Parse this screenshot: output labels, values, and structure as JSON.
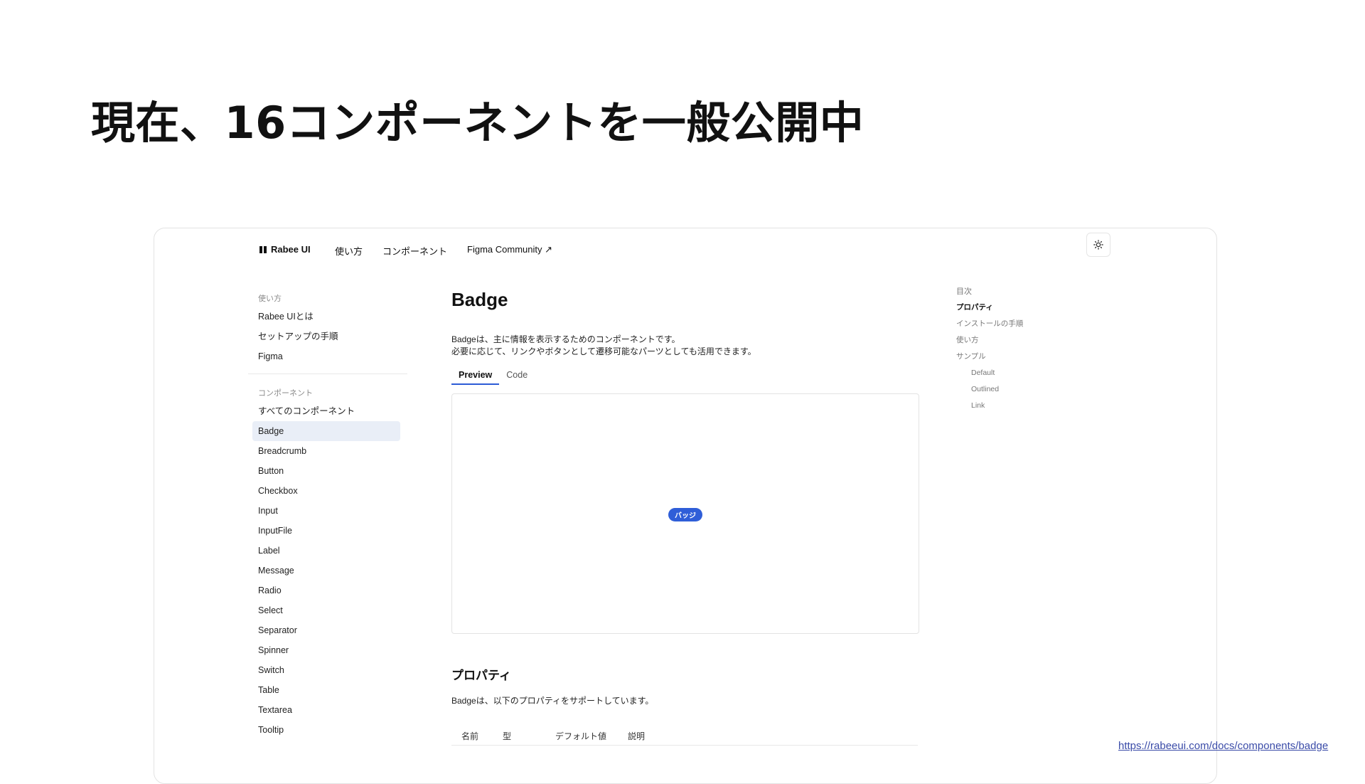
{
  "slide": {
    "title": "現在、16コンポーネントを一般公開中",
    "url": "https://rabeeui.com/docs/components/badge"
  },
  "nav": {
    "brand": "Rabee UI",
    "links": [
      "使い方",
      "コンポーネント",
      "Figma Community ↗"
    ]
  },
  "sidebar": {
    "usage_title": "使い方",
    "usage_items": [
      "Rabee UIとは",
      "セットアップの手順",
      "Figma"
    ],
    "components_title": "コンポーネント",
    "component_items": [
      "すべてのコンポーネント",
      "Badge",
      "Breadcrumb",
      "Button",
      "Checkbox",
      "Input",
      "InputFile",
      "Label",
      "Message",
      "Radio",
      "Select",
      "Separator",
      "Spinner",
      "Switch",
      "Table",
      "Textarea",
      "Tooltip"
    ],
    "active_item": "Badge"
  },
  "main": {
    "title": "Badge",
    "desc_line1": "Badgeは、主に情報を表示するためのコンポーネントです。",
    "desc_line2": "必要に応じて、リンクやボタンとして遷移可能なパーツとしても活用できます。",
    "tab_preview": "Preview",
    "tab_code": "Code",
    "badge_label": "バッジ",
    "props_title": "プロパティ",
    "props_desc": "Badgeは、以下のプロパティをサポートしています。",
    "table_headers": [
      "名前",
      "型",
      "デフォルト値",
      "説明"
    ]
  },
  "toc": {
    "title": "目次",
    "items": [
      "プロパティ",
      "インストールの手順",
      "使い方",
      "サンプル"
    ],
    "sub_items": [
      "Default",
      "Outlined",
      "Link"
    ]
  },
  "colors": {
    "accent": "#2f5ed8",
    "active_bg": "#e9eef7"
  }
}
